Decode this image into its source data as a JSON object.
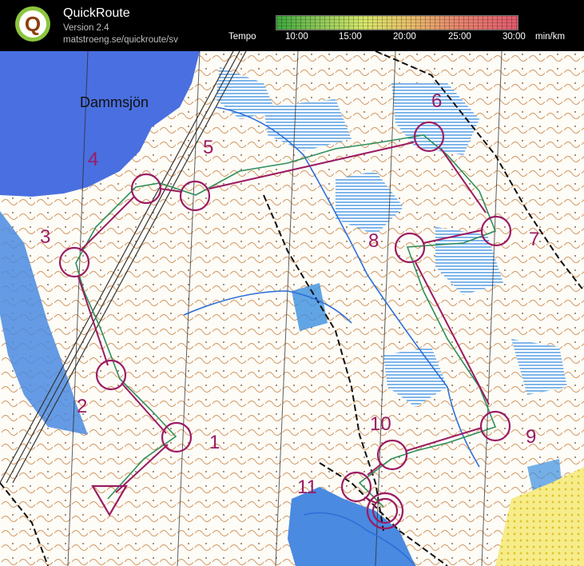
{
  "app": {
    "title": "QuickRoute",
    "version": "Version 2.4",
    "url": "matstroeng.se/quickroute/sv",
    "logo_letter": "Q"
  },
  "tempo": {
    "label": "Tempo",
    "ticks": [
      "10:00",
      "15:00",
      "20:00",
      "25:00",
      "30:00"
    ],
    "unit": "min/km",
    "colors": [
      "#3da83d",
      "#d8e86a",
      "#e25a6e"
    ]
  },
  "map": {
    "lake_name": "Dammsjön",
    "control_numbers": [
      "1",
      "2",
      "3",
      "4",
      "5",
      "6",
      "7",
      "8",
      "9",
      "10",
      "11"
    ],
    "colors": {
      "course": "#9b1b63",
      "water": "#4a6fe0",
      "marsh": "#3a8ee0",
      "contour": "#c4732a",
      "route": "#2f8f5a",
      "yellow": "#f2e24a"
    }
  }
}
